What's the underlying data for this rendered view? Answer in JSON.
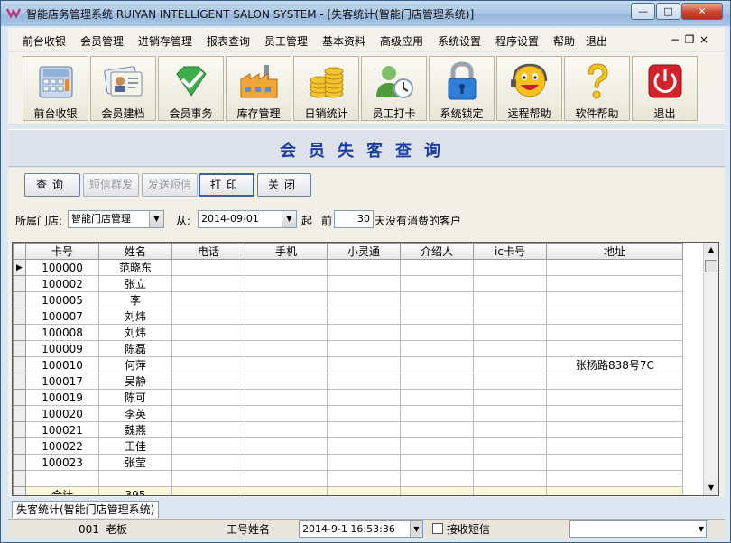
{
  "window": {
    "title": "智能店务管理系统 RUIYAN INTELLIGENT SALON SYSTEM - [失客统计(智能门店管理系统)]",
    "minimize": "—",
    "maximize": "□",
    "close": "✕"
  },
  "menu": [
    "前台收银",
    "会员管理",
    "进销存管理",
    "报表查询",
    "员工管理",
    "基本资料",
    "高级应用",
    "系统设置",
    "程序设置",
    "帮助",
    "退出"
  ],
  "mdi": {
    "minimize": "−",
    "restore": "❐",
    "close": "×"
  },
  "toolbar": [
    {
      "label": "前台收银",
      "icon": "calculator-icon"
    },
    {
      "label": "会员建档",
      "icon": "member-card-icon"
    },
    {
      "label": "会员事务",
      "icon": "check-gem-icon"
    },
    {
      "label": "库存管理",
      "icon": "factory-icon"
    },
    {
      "label": "日销统计",
      "icon": "coins-icon"
    },
    {
      "label": "员工打卡",
      "icon": "user-clock-icon"
    },
    {
      "label": "系统锁定",
      "icon": "lock-icon"
    },
    {
      "label": "远程帮助",
      "icon": "smiley-headset-icon"
    },
    {
      "label": "软件帮助",
      "icon": "question-icon"
    },
    {
      "label": "退出",
      "icon": "power-icon"
    }
  ],
  "heading": "会员失客查询",
  "actions": {
    "query": "查询",
    "sms_group": "短信群发",
    "sms_send": "发送短信",
    "print": "打印",
    "close": "关闭"
  },
  "filter": {
    "store_label": "所属门店:",
    "store_value": "智能门店管理",
    "from_label": "从:",
    "from_date": "2014-09-01",
    "start_label": "起",
    "before_label": "前",
    "days": "30",
    "days_suffix": "天没有消费的客户"
  },
  "table": {
    "columns": [
      "卡号",
      "姓名",
      "电话",
      "手机",
      "小灵通",
      "介绍人",
      "ic卡号",
      "地址"
    ],
    "rows": [
      [
        "100000",
        "范晓东",
        "",
        "",
        "",
        "",
        "",
        ""
      ],
      [
        "100002",
        "张立",
        "",
        "",
        "",
        "",
        "",
        ""
      ],
      [
        "100005",
        "李",
        "",
        "",
        "",
        "",
        "",
        ""
      ],
      [
        "100007",
        "刘炜",
        "",
        "",
        "",
        "",
        "",
        ""
      ],
      [
        "100008",
        "刘炜",
        "",
        "",
        "",
        "",
        "",
        ""
      ],
      [
        "100009",
        "陈磊",
        "",
        "",
        "",
        "",
        "",
        ""
      ],
      [
        "100010",
        "何萍",
        "",
        "",
        "",
        "",
        "",
        "张杨路838号7C"
      ],
      [
        "100017",
        "吴静",
        "",
        "",
        "",
        "",
        "",
        ""
      ],
      [
        "100019",
        "陈可",
        "",
        "",
        "",
        "",
        "",
        ""
      ],
      [
        "100020",
        "李英",
        "",
        "",
        "",
        "",
        "",
        ""
      ],
      [
        "100021",
        "魏燕",
        "",
        "",
        "",
        "",
        "",
        ""
      ],
      [
        "100022",
        "王佳",
        "",
        "",
        "",
        "",
        "",
        ""
      ],
      [
        "100023",
        "张莹",
        "",
        "",
        "",
        "",
        "",
        ""
      ]
    ],
    "total_label": "合计",
    "total_value": "395"
  },
  "tab": "失客统计(智能门店管理系统)",
  "status": {
    "code": "001",
    "user": "老板",
    "id_label": "工号姓名",
    "datetime": "2014-9-1  16:53:36",
    "sms_label": "接收短信"
  },
  "colors": {
    "heading": "#1a3ca8",
    "total_row": "#fbf7d8"
  }
}
